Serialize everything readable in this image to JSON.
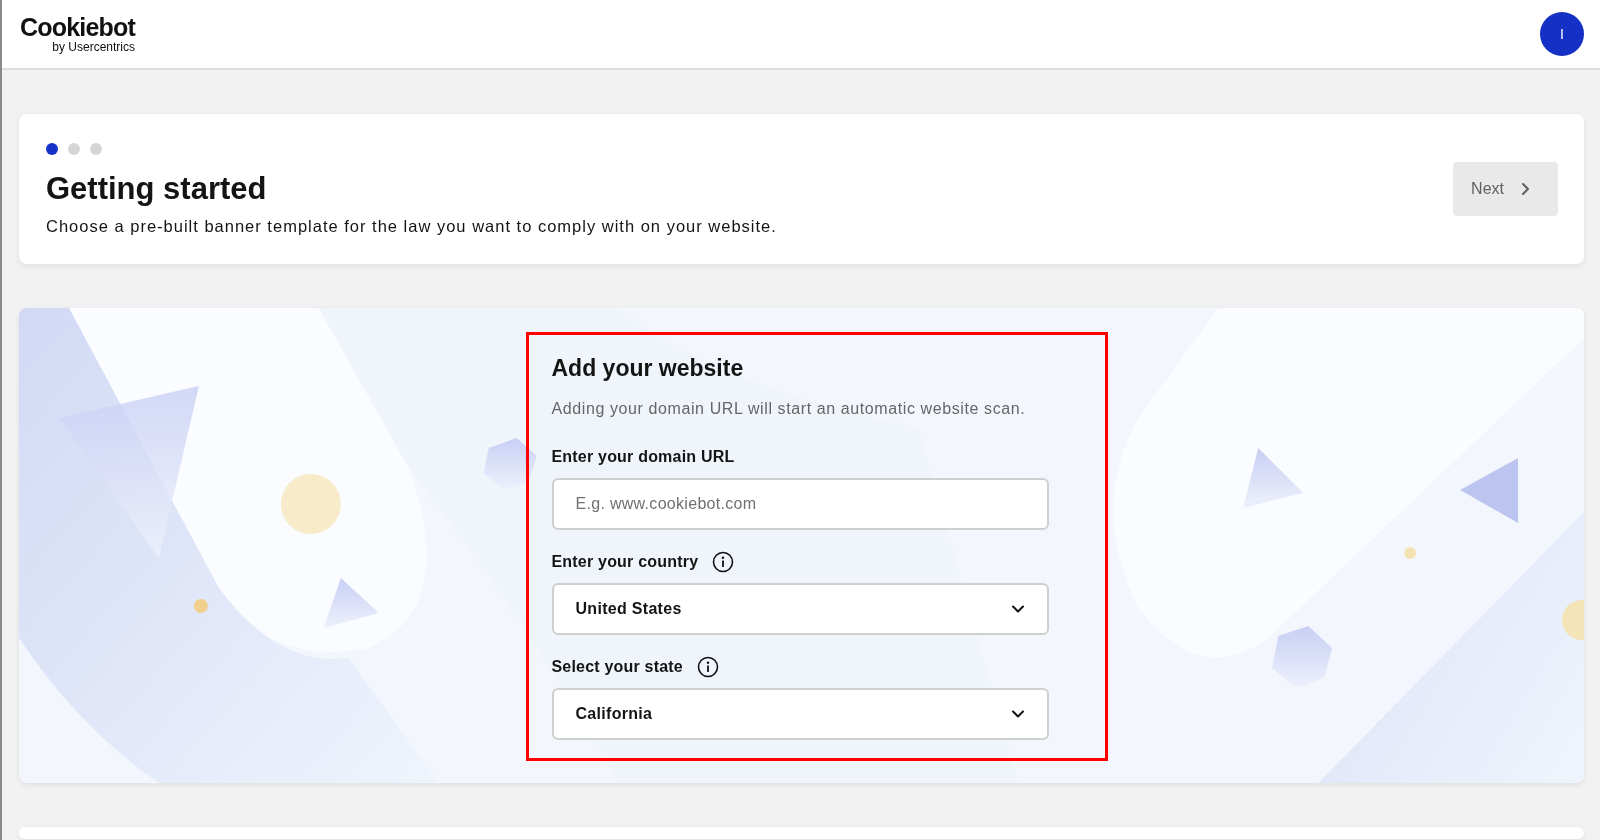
{
  "header": {
    "logo": {
      "name": "Cookiebot",
      "tagline": "by Usercentrics"
    },
    "avatar": {
      "initial": "I"
    }
  },
  "intro": {
    "steps": [
      {
        "selected": true
      },
      {
        "selected": false
      },
      {
        "selected": false
      }
    ],
    "title": "Getting started",
    "subtitle": "Choose a pre-built banner template for the law you want to comply with on your website.",
    "next_button": {
      "label": "Next",
      "disabled": true
    }
  },
  "form": {
    "kind": "picture",
    "highlighted": true,
    "title": "Add your website",
    "description": "Adding your domain URL will start an automatic website scan.",
    "fields": [
      {
        "kind": "text",
        "label": "Enter your domain URL",
        "info_icon": false,
        "placeholder": "E.g. www.cookiebot.com"
      },
      {
        "kind": "select",
        "label": "Enter your country",
        "info_icon": true,
        "value": "United States"
      },
      {
        "kind": "select",
        "label": "Select your state",
        "info_icon": true,
        "value": "California"
      }
    ]
  }
}
